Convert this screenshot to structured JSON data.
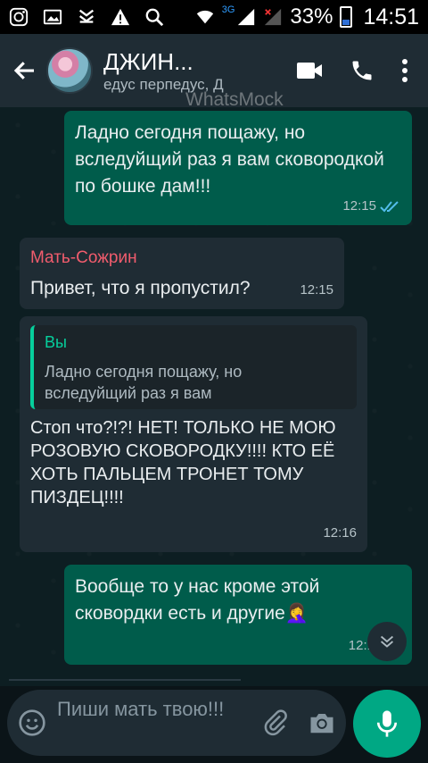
{
  "status_bar": {
    "battery": "33%",
    "time": "14:51",
    "network": "3G"
  },
  "header": {
    "title": "ДЖИН...",
    "subtitle": "едус перпедус, Д",
    "watermark": "WhatsMock"
  },
  "messages": [
    {
      "type": "outgoing",
      "text": "Ладно сегодня пощажу, но вследуйщий раз я вам сковородкой по бошке дам!!!",
      "time": "12:15",
      "status": "read-ticks-icon"
    },
    {
      "type": "incoming",
      "sender": "Мать-Сожрин",
      "text": "Привет, что я пропустил?",
      "time": "12:15"
    },
    {
      "type": "incoming",
      "quote_author": "Вы",
      "quote_text": "Ладно сегодня пощажу, но вследуйщий раз я вам",
      "text": "Стоп что?!?! НЕТ! ТОЛЬКО НЕ МОЮ  РОЗОВУЮ СКОВОРОДКУ!!!! КТО ЕЁ ХОТЬ ПАЛЬЦЕМ ТРОНЕТ ТОМУ ПИЗДЕЦ!!!!",
      "time": "12:16"
    },
    {
      "type": "outgoing",
      "text": "Вообще то у нас кроме этой сковордки есть и другие",
      "emoji": "🤦‍♀️",
      "time": "12:1"
    }
  ],
  "input": {
    "placeholder": "Пиши мать твою!!!"
  },
  "colors": {
    "header": "#1f2c34",
    "outgoing_bubble": "#005c4b",
    "incoming_bubble": "#1f2c34",
    "sender_name": "#f15c6d",
    "accent": "#00a884",
    "read_ticks": "#53bdeb"
  }
}
